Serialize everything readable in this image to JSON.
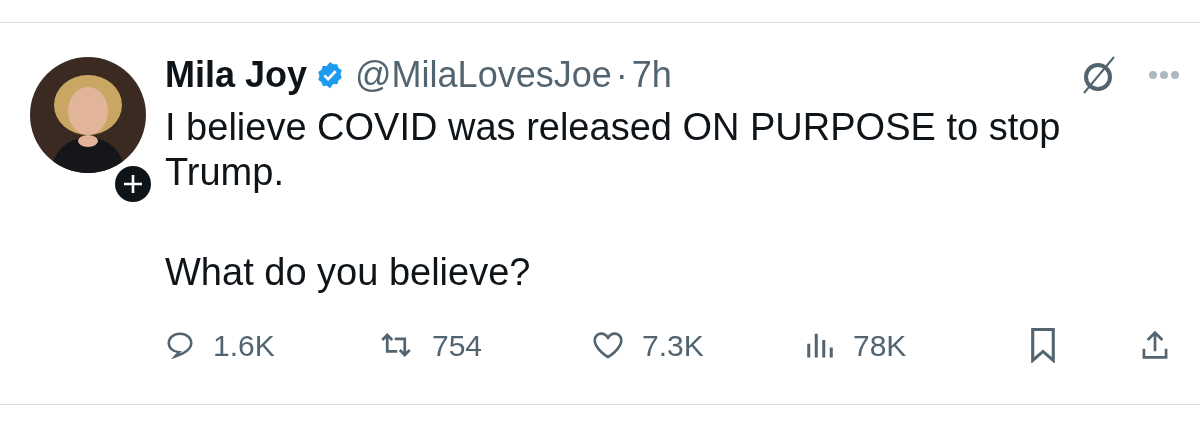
{
  "tweet": {
    "author": {
      "name": "Mila Joy",
      "verified": true,
      "handle": "@MilaLovesJoe",
      "separator": "·",
      "time": "7h"
    },
    "body": [
      "I believe COVID was released ON PURPOSE to stop Trump.",
      "What do you believe?"
    ],
    "actions": [
      {
        "kind": "reply",
        "count": "1.6K"
      },
      {
        "kind": "retweet",
        "count": "754"
      },
      {
        "kind": "like",
        "count": "7.3K"
      },
      {
        "kind": "views",
        "count": "78K"
      },
      {
        "kind": "bookmark"
      },
      {
        "kind": "share"
      }
    ]
  }
}
